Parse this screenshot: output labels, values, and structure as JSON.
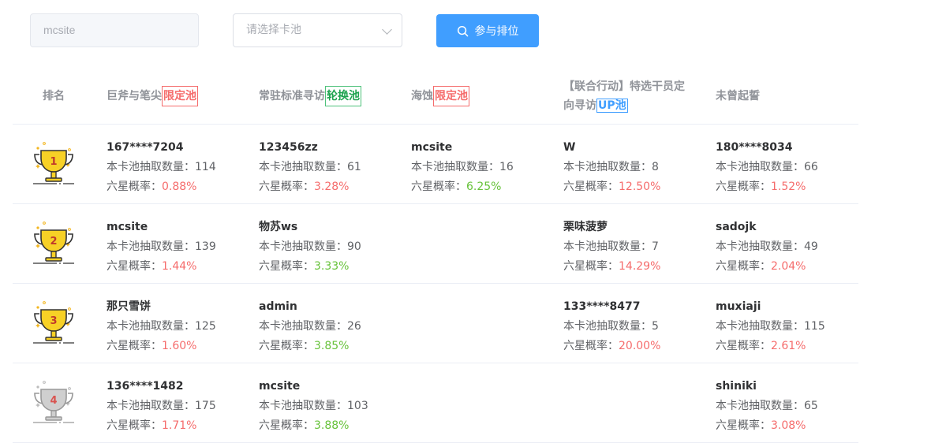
{
  "toolbar": {
    "search_value": "mcsite",
    "select_placeholder": "请选择卡池",
    "join_label": "参与排位"
  },
  "headers": {
    "rank": "排名",
    "col1_name": "巨斧与笔尖",
    "col1_tag": "限定池",
    "col2_name": "常驻标准寻访",
    "col2_tag": "轮换池",
    "col3_name": "海蚀",
    "col3_tag": "限定池",
    "col4_name_line1": "【联合行动】特选干员定",
    "col4_name_line2": "向寻访",
    "col4_tag": "UP池",
    "col5_name": "未曾起誓"
  },
  "labels": {
    "count": "本卡池抽取数量：",
    "rate": "六星概率："
  },
  "colors": {
    "accent": "#409eff",
    "rate_high": "#f56c6c",
    "rate_low": "#67c23a"
  },
  "rows": [
    {
      "rank": "1",
      "cells": [
        {
          "name": "167****7204",
          "count": "114",
          "rate": "0.88%",
          "rate_color": "red"
        },
        {
          "name": "123456zz",
          "count": "61",
          "rate": "3.28%",
          "rate_color": "red"
        },
        {
          "name": "mcsite",
          "count": "16",
          "rate": "6.25%",
          "rate_color": "green"
        },
        {
          "name": "W",
          "count": "8",
          "rate": "12.50%",
          "rate_color": "red"
        },
        {
          "name": "180****8034",
          "count": "66",
          "rate": "1.52%",
          "rate_color": "red"
        }
      ]
    },
    {
      "rank": "2",
      "cells": [
        {
          "name": "mcsite",
          "count": "139",
          "rate": "1.44%",
          "rate_color": "red"
        },
        {
          "name": "物苏ws",
          "count": "90",
          "rate": "3.33%",
          "rate_color": "green"
        },
        null,
        {
          "name": "栗味菠萝",
          "count": "7",
          "rate": "14.29%",
          "rate_color": "red"
        },
        {
          "name": "sadojk",
          "count": "49",
          "rate": "2.04%",
          "rate_color": "red"
        }
      ]
    },
    {
      "rank": "3",
      "cells": [
        {
          "name": "那只雪饼",
          "count": "125",
          "rate": "1.60%",
          "rate_color": "red"
        },
        {
          "name": "admin",
          "count": "26",
          "rate": "3.85%",
          "rate_color": "green"
        },
        null,
        {
          "name": "133****8477",
          "count": "5",
          "rate": "20.00%",
          "rate_color": "red"
        },
        {
          "name": "muxiaji",
          "count": "115",
          "rate": "2.61%",
          "rate_color": "red"
        }
      ]
    },
    {
      "rank": "4",
      "cells": [
        {
          "name": "136****1482",
          "count": "175",
          "rate": "1.71%",
          "rate_color": "red"
        },
        {
          "name": "mcsite",
          "count": "103",
          "rate": "3.88%",
          "rate_color": "green"
        },
        null,
        null,
        {
          "name": "shiniki",
          "count": "65",
          "rate": "3.08%",
          "rate_color": "red"
        }
      ]
    }
  ]
}
